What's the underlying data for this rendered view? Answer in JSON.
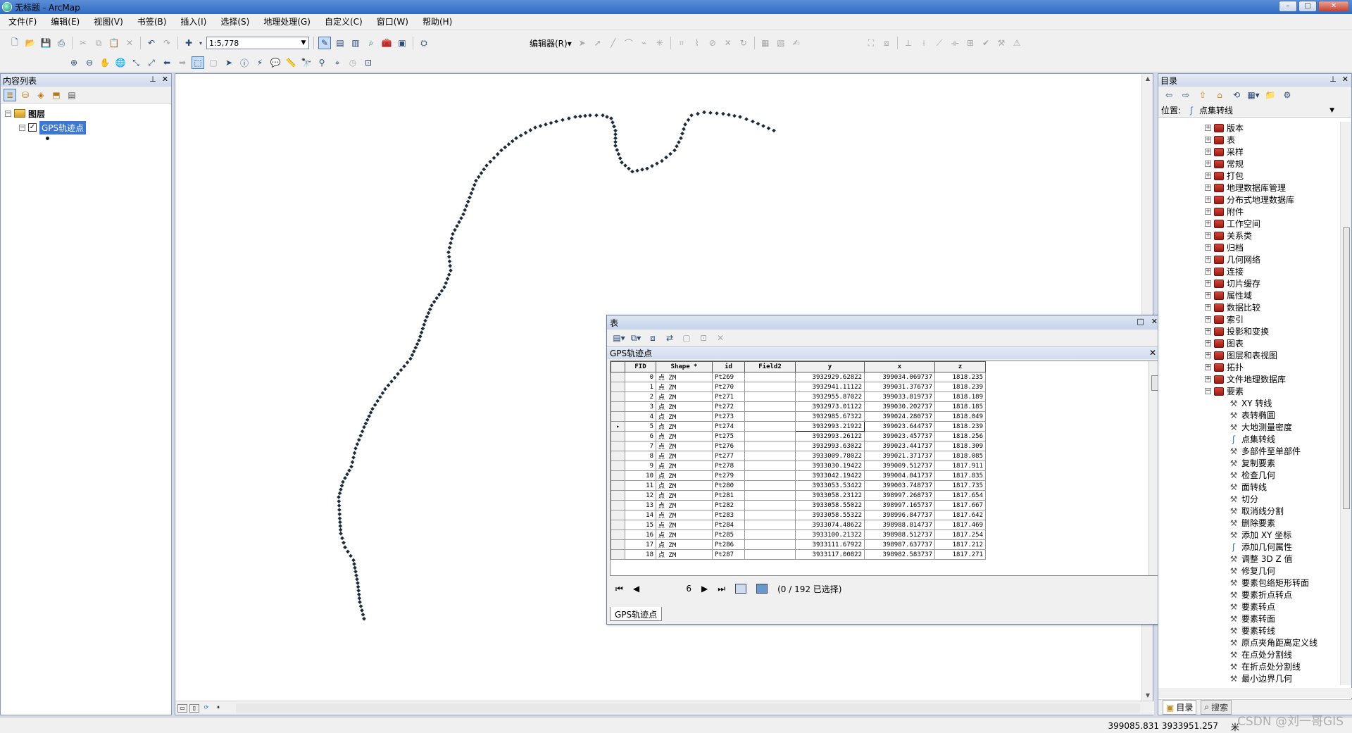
{
  "window": {
    "title": "无标题 - ArcMap",
    "min": "–",
    "max": "□",
    "close": "✕"
  },
  "menu": [
    "文件(F)",
    "编辑(E)",
    "视图(V)",
    "书签(B)",
    "插入(I)",
    "选择(S)",
    "地理处理(G)",
    "自定义(C)",
    "窗口(W)",
    "帮助(H)"
  ],
  "toolbar": {
    "scale": "1:5,778",
    "editor_label": "编辑器(R)▾"
  },
  "toc": {
    "title": "内容列表",
    "pin": "⊥",
    "close": "✕",
    "root_layer": "图层",
    "layer_name": "GPS轨迹点"
  },
  "table_window": {
    "title": "表",
    "tab_title": "GPS轨迹点",
    "bottom_tab": "GPS轨迹点",
    "columns": [
      "FID",
      "Shape *",
      "id",
      "Field2",
      "y",
      "x",
      "z"
    ],
    "rows": [
      [
        "0",
        "点 ZM",
        "Pt269",
        "",
        "3932929.62822",
        "399034.069737",
        "1818.235"
      ],
      [
        "1",
        "点 ZM",
        "Pt270",
        "",
        "3932941.11122",
        "399031.376737",
        "1818.239"
      ],
      [
        "2",
        "点 ZM",
        "Pt271",
        "",
        "3932955.87022",
        "399033.819737",
        "1818.189"
      ],
      [
        "3",
        "点 ZM",
        "Pt272",
        "",
        "3932973.01122",
        "399030.202737",
        "1818.185"
      ],
      [
        "4",
        "点 ZM",
        "Pt273",
        "",
        "3932985.67322",
        "399024.280737",
        "1818.049"
      ],
      [
        "5",
        "点 ZM",
        "Pt274",
        "",
        "3932993.21922",
        "399023.644737",
        "1818.239"
      ],
      [
        "6",
        "点 ZM",
        "Pt275",
        "",
        "3932993.26122",
        "399023.457737",
        "1818.256"
      ],
      [
        "7",
        "点 ZM",
        "Pt276",
        "",
        "3932993.63022",
        "399023.441737",
        "1818.309"
      ],
      [
        "8",
        "点 ZM",
        "Pt277",
        "",
        "3933009.78022",
        "399021.371737",
        "1818.085"
      ],
      [
        "9",
        "点 ZM",
        "Pt278",
        "",
        "3933030.19422",
        "399009.512737",
        "1817.911"
      ],
      [
        "10",
        "点 ZM",
        "Pt279",
        "",
        "3933042.19422",
        "399004.041737",
        "1817.835"
      ],
      [
        "11",
        "点 ZM",
        "Pt280",
        "",
        "3933053.53422",
        "399003.748737",
        "1817.735"
      ],
      [
        "12",
        "点 ZM",
        "Pt281",
        "",
        "3933058.23122",
        "398997.268737",
        "1817.654"
      ],
      [
        "13",
        "点 ZM",
        "Pt282",
        "",
        "3933058.55022",
        "398997.165737",
        "1817.667"
      ],
      [
        "14",
        "点 ZM",
        "Pt283",
        "",
        "3933058.55322",
        "398996.847737",
        "1817.642"
      ],
      [
        "15",
        "点 ZM",
        "Pt284",
        "",
        "3933074.48622",
        "398988.814737",
        "1817.469"
      ],
      [
        "16",
        "点 ZM",
        "Pt285",
        "",
        "3933100.21322",
        "398988.512737",
        "1817.254"
      ],
      [
        "17",
        "点 ZM",
        "Pt286",
        "",
        "3933111.67922",
        "398987.637737",
        "1817.212"
      ],
      [
        "18",
        "点 ZM",
        "Pt287",
        "",
        "3933117.00822",
        "398982.583737",
        "1817.271"
      ]
    ],
    "current_record": "6",
    "selection": "(0 / 192 已选择)"
  },
  "catalog": {
    "title": "目录",
    "location_label": "位置:",
    "location_value": "点集转线",
    "toolsets": [
      "版本",
      "表",
      "采样",
      "常规",
      "打包",
      "地理数据库管理",
      "分布式地理数据库",
      "附件",
      "工作空间",
      "关系类",
      "归档",
      "几何网络",
      "连接",
      "切片缓存",
      "属性域",
      "数据比较",
      "索引",
      "投影和变换",
      "图表",
      "图层和表视图",
      "拓扑",
      "文件地理数据库",
      "要素"
    ],
    "tools": [
      "XY 转线",
      "表转椭圆",
      "大地测量密度",
      "点集转线",
      "多部件至单部件",
      "复制要素",
      "检查几何",
      "面转线",
      "切分",
      "取消线分割",
      "删除要素",
      "添加 XY 坐标",
      "添加几何属性",
      "调整 3D Z 值",
      "修复几何",
      "要素包络矩形转面",
      "要素折点转点",
      "要素转点",
      "要素转面",
      "要素转线",
      "原点夹角距离定义线",
      "在点处分割线",
      "在折点处分割线",
      "最小边界几何"
    ],
    "script_tools": [
      "点集转线",
      "添加几何属性"
    ],
    "tab_catalog": "目录",
    "tab_search": "搜索"
  },
  "status": {
    "coords": "399085.831  3933951.257",
    "units": "米"
  },
  "watermark": "CSDN @刘一哥GIS",
  "colors": {
    "selection": "#3a77d6",
    "points": "#1b2b3b"
  }
}
